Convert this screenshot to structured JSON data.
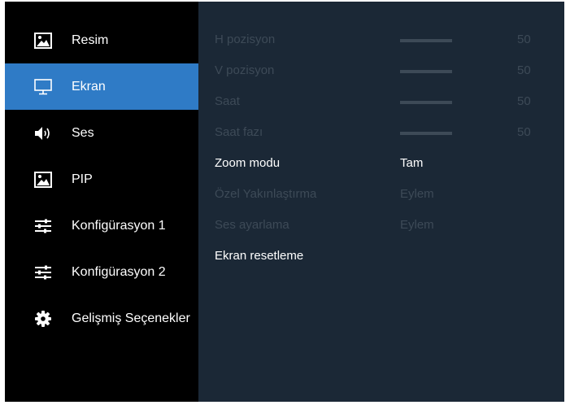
{
  "sidebar": {
    "items": [
      {
        "label": "Resim",
        "icon": "picture-icon",
        "active": false
      },
      {
        "label": "Ekran",
        "icon": "monitor-icon",
        "active": true
      },
      {
        "label": "Ses",
        "icon": "speaker-icon",
        "active": false
      },
      {
        "label": "PIP",
        "icon": "picture-icon",
        "active": false
      },
      {
        "label": "Konfigürasyon 1",
        "icon": "sliders-icon",
        "active": false
      },
      {
        "label": "Konfigürasyon 2",
        "icon": "sliders-icon",
        "active": false
      },
      {
        "label": "Gelişmiş Seçenekler",
        "icon": "gear-icon",
        "active": false
      }
    ]
  },
  "content": {
    "rows": [
      {
        "label": "H pozisyon",
        "value": "50",
        "bar_fraction": 0.5,
        "enabled": false
      },
      {
        "label": "V pozisyon",
        "value": "50",
        "bar_fraction": 0.5,
        "enabled": false
      },
      {
        "label": "Saat",
        "value": "50",
        "bar_fraction": 0.5,
        "enabled": false
      },
      {
        "label": "Saat fazı",
        "value": "50",
        "bar_fraction": 0.5,
        "enabled": false
      },
      {
        "label": "Zoom modu",
        "value": "Tam",
        "enabled": true
      },
      {
        "label": "Özel Yakınlaştırma",
        "value": "Eylem",
        "enabled": false
      },
      {
        "label": "Ses ayarlama",
        "value": "Eylem",
        "enabled": false
      },
      {
        "label": "Ekran resetleme",
        "enabled": true
      }
    ]
  },
  "colors": {
    "background": "#000000",
    "active_highlight": "#2f7bc6",
    "content_panel": "#1b2836",
    "enabled_text": "#ffffff",
    "disabled_text": "#3d4a57"
  }
}
